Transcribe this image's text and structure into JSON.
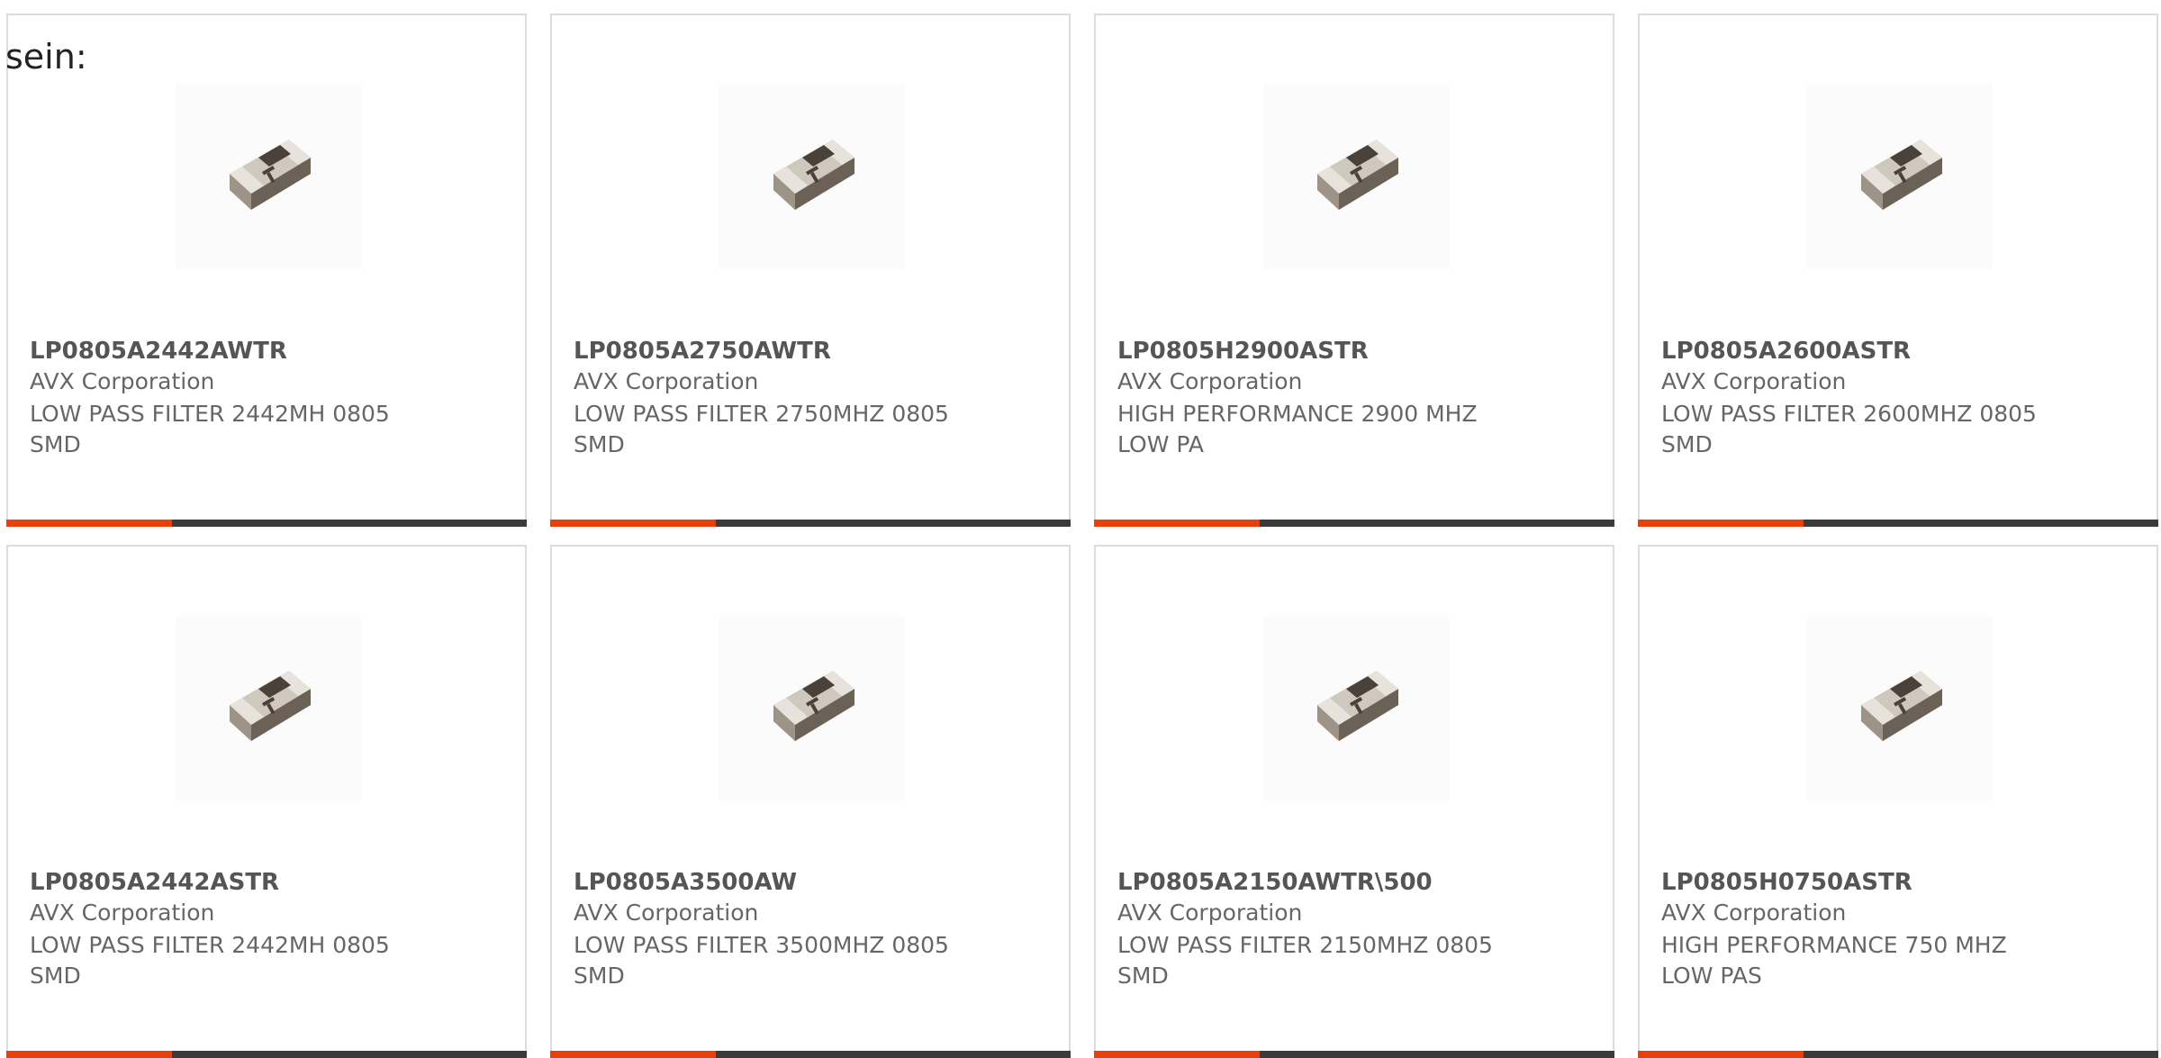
{
  "lead_text": "sein:",
  "colors": {
    "accent": "#e8400c",
    "bar": "#3b3b3b",
    "border": "#dcdcdc"
  },
  "products": [
    {
      "part_number": "LP0805A2442AWTR",
      "manufacturer": "AVX Corporation",
      "description": "LOW PASS FILTER 2442MH 0805 SMD",
      "image": "smd-chip-filter-image"
    },
    {
      "part_number": "LP0805A2750AWTR",
      "manufacturer": "AVX Corporation",
      "description": "LOW PASS FILTER 2750MHZ 0805 SMD",
      "image": "smd-chip-filter-image"
    },
    {
      "part_number": "LP0805H2900ASTR",
      "manufacturer": "AVX Corporation",
      "description": "HIGH PERFORMANCE 2900 MHZ LOW PA",
      "image": "smd-chip-filter-image"
    },
    {
      "part_number": "LP0805A2600ASTR",
      "manufacturer": "AVX Corporation",
      "description": "LOW PASS FILTER 2600MHZ 0805 SMD",
      "image": "smd-chip-filter-image"
    },
    {
      "part_number": "LP0805A2442ASTR",
      "manufacturer": "AVX Corporation",
      "description": "LOW PASS FILTER 2442MH 0805 SMD",
      "image": "smd-chip-filter-image"
    },
    {
      "part_number": "LP0805A3500AW",
      "manufacturer": "AVX Corporation",
      "description": "LOW PASS FILTER 3500MHZ 0805 SMD",
      "image": "smd-chip-filter-image"
    },
    {
      "part_number": "LP0805A2150AWTR\\500",
      "manufacturer": "AVX Corporation",
      "description": "LOW PASS FILTER 2150MHZ 0805 SMD",
      "image": "smd-chip-filter-image"
    },
    {
      "part_number": "LP0805H0750ASTR",
      "manufacturer": "AVX Corporation",
      "description": "HIGH PERFORMANCE 750 MHZ LOW PAS",
      "image": "smd-chip-filter-image"
    }
  ]
}
